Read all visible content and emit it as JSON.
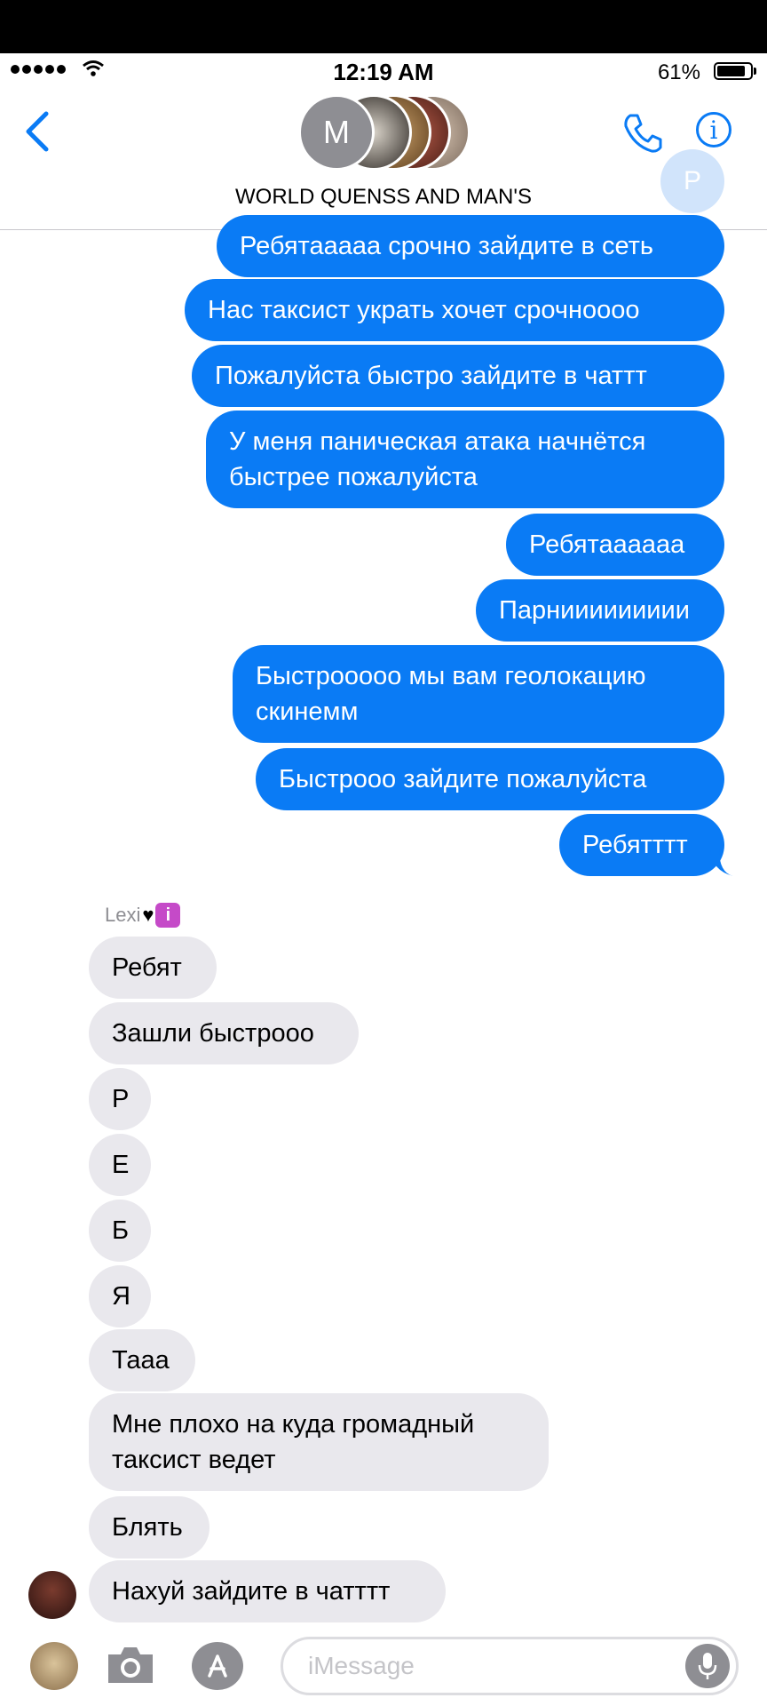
{
  "status_bar": {
    "time": "12:19 AM",
    "battery": "61%"
  },
  "header": {
    "group_name": "WORLD QUENSS AND MAN'S",
    "avatar_initial": "M",
    "typing_avatar_initial": "P"
  },
  "colors": {
    "accent": "#0a7bf5",
    "incoming": "#e9e8ed",
    "outgoing": "#0a7bf5"
  },
  "outgoing_messages": [
    "Ребятааааа срочно зайдите в сеть",
    "Нас таксист украть хочет срочнoooo",
    "Пожалуйста быстро зайдите в чаттт",
    "У меня паническая атака начнётся быстрее пожалуйста",
    "Ребятаааааа",
    "Парниииииииии",
    "Быстроoooo мы вам геолокацию скинемм",
    "Быстрооо зайдите пожалуйста",
    "Ребятттт"
  ],
  "incoming": {
    "sender": "Lexi",
    "messages": [
      "Ребят",
      "Зашли быстрооо",
      "Р",
      "Е",
      "Б",
      "Я",
      "Тааа",
      "Мне плохо на куда громадный таксист ведет",
      "Блять",
      "Нахуй зайдите в чатттт"
    ]
  },
  "input": {
    "placeholder": "iMessage"
  },
  "icons": [
    "back-chevron-icon",
    "phone-icon",
    "info-icon",
    "camera-icon",
    "app-store-icon",
    "microphone-icon"
  ]
}
